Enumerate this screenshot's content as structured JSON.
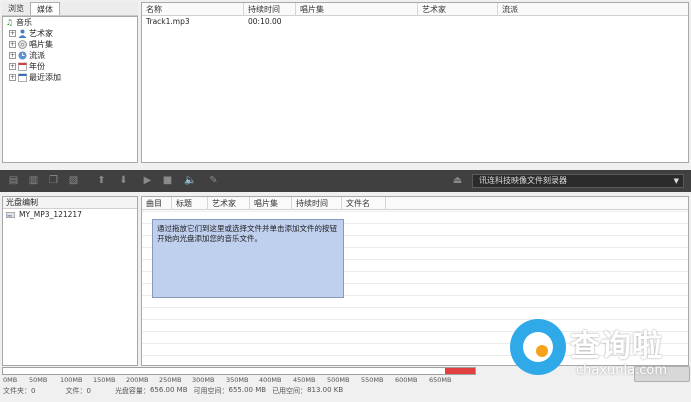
{
  "tabs": [
    {
      "label": "浏览"
    },
    {
      "label": "媒体"
    }
  ],
  "tree": {
    "root": "音乐",
    "items": [
      {
        "label": "艺术家",
        "icon": "person-icon"
      },
      {
        "label": "唱片集",
        "icon": "disc-icon"
      },
      {
        "label": "流派",
        "icon": "genre-icon"
      },
      {
        "label": "年份",
        "icon": "calendar-icon"
      },
      {
        "label": "最近添加",
        "icon": "recent-icon"
      }
    ]
  },
  "tracklist": {
    "columns": [
      "名称",
      "持续时间",
      "唱片集",
      "艺术家",
      "流派"
    ],
    "rows": [
      {
        "name": "Track1.mp3",
        "duration": "00:10.00",
        "album": "",
        "artist": "",
        "genre": ""
      }
    ]
  },
  "toolbar": {
    "icons": [
      "new-compilation-icon",
      "add-file-icon",
      "copy-icon",
      "delete-icon",
      "move-up-icon",
      "move-down-icon",
      "play-icon",
      "stop-icon",
      "volume-icon",
      "edit-icon"
    ],
    "burner_label": "讯连科技映像文件刻录器"
  },
  "disc": {
    "title": "光盘编制",
    "item": "MY_MP3_121217"
  },
  "complist": {
    "columns": [
      "曲目",
      "标题",
      "艺术家",
      "唱片集",
      "持续时间",
      "文件名"
    ],
    "hint": "通过拖放它们到这里或选择文件并单击添加文件的按钮开始向光盘添加您的音乐文件。"
  },
  "capacity": {
    "ticks": [
      "0MB",
      "50MB",
      "100MB",
      "150MB",
      "200MB",
      "250MB",
      "300MB",
      "350MB",
      "400MB",
      "450MB",
      "500MB",
      "550MB",
      "600MB",
      "650MB"
    ]
  },
  "status": {
    "folders": "文件夹：0",
    "files": "文件：0",
    "disc_capacity": "光盘容量：",
    "disc_capacity_value": "656.00 MB",
    "free_label": "可用空间：",
    "free_value": "655.00 MB",
    "used_label": "已用空间：",
    "used_value": "813.00 KB"
  },
  "watermark": {
    "text": "查询啦",
    "url": "chaxunla.com"
  },
  "colors": {
    "toolbar": "#404040",
    "hint_bg": "#bfcfee",
    "capacity_over": "#e04040",
    "watermark_blue": "#2fa9e8",
    "watermark_orange": "#f7a21b"
  }
}
